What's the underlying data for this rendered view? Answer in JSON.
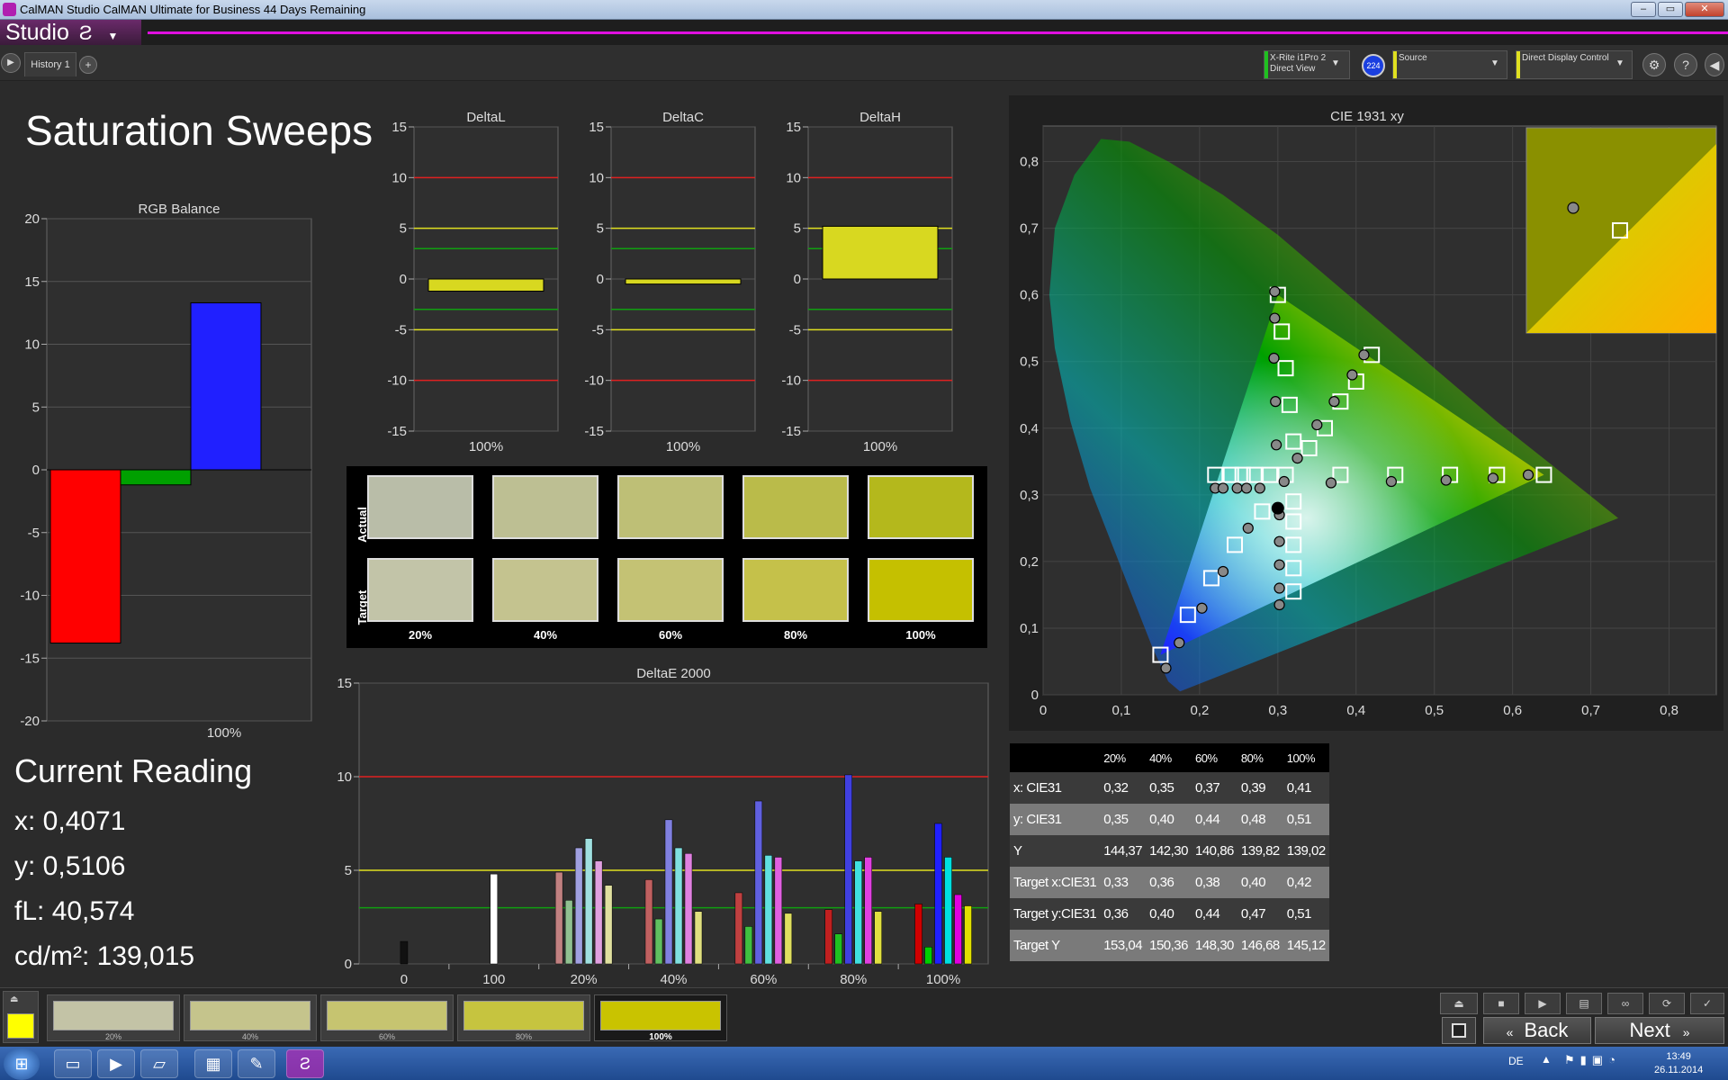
{
  "window": {
    "title": "CalMAN Studio CalMAN Ultimate for Business 44 Days Remaining",
    "minimize": "–",
    "maximize": "▭",
    "close": "✕"
  },
  "app": {
    "brand": "Studio",
    "brand_icon": "Ƨ",
    "tab": "History 1",
    "tab_add": "+"
  },
  "devices": {
    "meter": [
      "X-Rite i1Pro 2",
      "Direct View"
    ],
    "meter_badge": "224",
    "source": "Source",
    "display": "Direct Display Control"
  },
  "page_title": "Saturation Sweeps",
  "current_reading": {
    "title": "Current Reading",
    "x": "x: 0,4071",
    "y": "y: 0,5106",
    "fl": "fL: 40,574",
    "cdm": "cd/m²: 139,015"
  },
  "swatch_rows": {
    "actual": "Actual",
    "target": "Target"
  },
  "swatch_labels": [
    "20%",
    "40%",
    "60%",
    "80%",
    "100%"
  ],
  "swatch_colors": {
    "actual": [
      "#b9bda8",
      "#bdbf93",
      "#bebf76",
      "#babb4a",
      "#b4b81c"
    ],
    "target": [
      "#c2c4a8",
      "#c4c38f",
      "#c4c274",
      "#c5c14a",
      "#c5c000"
    ]
  },
  "table": {
    "header": [
      "",
      "20%",
      "40%",
      "60%",
      "80%",
      "100%"
    ],
    "rows": [
      [
        "x: CIE31",
        "0,32",
        "0,35",
        "0,37",
        "0,39",
        "0,41"
      ],
      [
        "y: CIE31",
        "0,35",
        "0,40",
        "0,44",
        "0,48",
        "0,51"
      ],
      [
        "Y",
        "144,37",
        "142,30",
        "140,86",
        "139,82",
        "139,02"
      ],
      [
        "Target x:CIE31",
        "0,33",
        "0,36",
        "0,38",
        "0,40",
        "0,42"
      ],
      [
        "Target y:CIE31",
        "0,36",
        "0,40",
        "0,44",
        "0,47",
        "0,51"
      ],
      [
        "Target Y",
        "153,04",
        "150,36",
        "148,30",
        "146,68",
        "145,12"
      ]
    ]
  },
  "bottom_swatches": [
    {
      "label": "20%",
      "color": "#c3c3a6"
    },
    {
      "label": "40%",
      "color": "#c5c48c"
    },
    {
      "label": "60%",
      "color": "#c6c470"
    },
    {
      "label": "80%",
      "color": "#c6c43f"
    },
    {
      "label": "100%",
      "color": "#c9c300"
    }
  ],
  "nav": {
    "back": "Back",
    "next": "Next"
  },
  "taskbar": {
    "lang": "DE",
    "time": "13:49",
    "date": "26.11.2014"
  },
  "chart_data": [
    {
      "type": "bar",
      "title": "RGB Balance",
      "categories": [
        "100%"
      ],
      "series": [
        {
          "color": "#ff0000",
          "value": -13.8
        },
        {
          "color": "#00a000",
          "value": -1.2
        },
        {
          "color": "#2020ff",
          "value": 13.3
        }
      ],
      "ylim": [
        -20,
        20
      ],
      "yticks": [
        -20,
        -15,
        -10,
        -5,
        0,
        5,
        10,
        15,
        20
      ]
    },
    {
      "type": "bar",
      "title": "DeltaL",
      "categories": [
        "100%"
      ],
      "values": [
        -1.2
      ],
      "ylim": [
        -15,
        15
      ],
      "yticks": [
        -15,
        -10,
        -5,
        0,
        5,
        10,
        15
      ]
    },
    {
      "type": "bar",
      "title": "DeltaC",
      "categories": [
        "100%"
      ],
      "values": [
        -0.5
      ],
      "ylim": [
        -15,
        15
      ],
      "yticks": [
        -15,
        -10,
        -5,
        0,
        5,
        10,
        15
      ]
    },
    {
      "type": "bar",
      "title": "DeltaH",
      "categories": [
        "100%"
      ],
      "values": [
        5.2
      ],
      "ylim": [
        -15,
        15
      ],
      "yticks": [
        -15,
        -10,
        -5,
        0,
        5,
        10,
        15
      ]
    },
    {
      "type": "bar",
      "title": "DeltaE 2000",
      "categories": [
        "0",
        "100",
        "20%",
        "40%",
        "60%",
        "80%",
        "100%"
      ],
      "ylim": [
        0,
        15
      ],
      "yticks": [
        0,
        5,
        10,
        15
      ],
      "groups": [
        {
          "cat": "0",
          "bars": [
            {
              "v": 1.2,
              "c": "#111"
            }
          ]
        },
        {
          "cat": "100",
          "bars": [
            {
              "v": 4.8,
              "c": "#ffffff"
            }
          ]
        },
        {
          "cat": "20%",
          "bars": [
            {
              "v": 4.9,
              "c": "#c08080"
            },
            {
              "v": 3.4,
              "c": "#90c090"
            },
            {
              "v": 6.2,
              "c": "#a0a0e0"
            },
            {
              "v": 6.7,
              "c": "#a0e0e0"
            },
            {
              "v": 5.5,
              "c": "#e0a0e0"
            },
            {
              "v": 4.2,
              "c": "#e0e0a0"
            }
          ]
        },
        {
          "cat": "40%",
          "bars": [
            {
              "v": 4.5,
              "c": "#c06060"
            },
            {
              "v": 2.4,
              "c": "#60c060"
            },
            {
              "v": 7.7,
              "c": "#8080e0"
            },
            {
              "v": 6.2,
              "c": "#80e0e0"
            },
            {
              "v": 5.9,
              "c": "#e080e0"
            },
            {
              "v": 2.8,
              "c": "#e0e080"
            }
          ]
        },
        {
          "cat": "60%",
          "bars": [
            {
              "v": 3.8,
              "c": "#c04040"
            },
            {
              "v": 2.0,
              "c": "#40c040"
            },
            {
              "v": 8.7,
              "c": "#6060e0"
            },
            {
              "v": 5.8,
              "c": "#60e0e0"
            },
            {
              "v": 5.7,
              "c": "#e060e0"
            },
            {
              "v": 2.7,
              "c": "#e0e060"
            }
          ]
        },
        {
          "cat": "80%",
          "bars": [
            {
              "v": 2.9,
              "c": "#c02020"
            },
            {
              "v": 1.6,
              "c": "#20c020"
            },
            {
              "v": 10.1,
              "c": "#4040e0"
            },
            {
              "v": 5.5,
              "c": "#40e0e0"
            },
            {
              "v": 5.7,
              "c": "#e040e0"
            },
            {
              "v": 2.8,
              "c": "#e0e040"
            }
          ]
        },
        {
          "cat": "100%",
          "bars": [
            {
              "v": 3.2,
              "c": "#d00000"
            },
            {
              "v": 0.9,
              "c": "#00d000"
            },
            {
              "v": 7.5,
              "c": "#2020ff"
            },
            {
              "v": 5.7,
              "c": "#00e0e0"
            },
            {
              "v": 3.7,
              "c": "#e000e0"
            },
            {
              "v": 3.1,
              "c": "#e0e000"
            }
          ]
        }
      ]
    },
    {
      "type": "scatter",
      "title": "CIE 1931 xy",
      "xlim": [
        0,
        0.85
      ],
      "ylim": [
        0,
        0.85
      ],
      "xticks": [
        "0",
        "0,1",
        "0,2",
        "0,3",
        "0,4",
        "0,5",
        "0,6",
        "0,7",
        "0,8"
      ],
      "yticks": [
        "0",
        "0,1",
        "0,2",
        "0,3",
        "0,4",
        "0,5",
        "0,6",
        "0,7",
        "0,8"
      ],
      "gamut": [
        [
          0.64,
          0.33
        ],
        [
          0.3,
          0.6
        ],
        [
          0.15,
          0.06
        ]
      ],
      "targets": [
        [
          0.3,
          0.6
        ],
        [
          0.305,
          0.545
        ],
        [
          0.31,
          0.49
        ],
        [
          0.315,
          0.435
        ],
        [
          0.32,
          0.38
        ],
        [
          0.42,
          0.51
        ],
        [
          0.4,
          0.47
        ],
        [
          0.38,
          0.44
        ],
        [
          0.36,
          0.4
        ],
        [
          0.34,
          0.37
        ],
        [
          0.64,
          0.33
        ],
        [
          0.58,
          0.33
        ],
        [
          0.52,
          0.33
        ],
        [
          0.45,
          0.33
        ],
        [
          0.38,
          0.33
        ],
        [
          0.15,
          0.06
        ],
        [
          0.185,
          0.12
        ],
        [
          0.215,
          0.175
        ],
        [
          0.245,
          0.225
        ],
        [
          0.28,
          0.275
        ],
        [
          0.32,
          0.155
        ],
        [
          0.32,
          0.19
        ],
        [
          0.32,
          0.225
        ],
        [
          0.32,
          0.26
        ],
        [
          0.32,
          0.29
        ],
        [
          0.22,
          0.33
        ],
        [
          0.24,
          0.33
        ],
        [
          0.255,
          0.33
        ],
        [
          0.27,
          0.33
        ],
        [
          0.29,
          0.33
        ],
        [
          0.31,
          0.33
        ]
      ],
      "actual": [
        [
          0.296,
          0.605
        ],
        [
          0.296,
          0.565
        ],
        [
          0.295,
          0.505
        ],
        [
          0.297,
          0.44
        ],
        [
          0.298,
          0.375
        ],
        [
          0.41,
          0.51
        ],
        [
          0.395,
          0.48
        ],
        [
          0.372,
          0.44
        ],
        [
          0.35,
          0.405
        ],
        [
          0.325,
          0.355
        ],
        [
          0.62,
          0.33
        ],
        [
          0.575,
          0.325
        ],
        [
          0.515,
          0.322
        ],
        [
          0.445,
          0.32
        ],
        [
          0.368,
          0.318
        ],
        [
          0.157,
          0.04
        ],
        [
          0.174,
          0.078
        ],
        [
          0.203,
          0.13
        ],
        [
          0.23,
          0.185
        ],
        [
          0.262,
          0.25
        ],
        [
          0.302,
          0.135
        ],
        [
          0.302,
          0.16
        ],
        [
          0.302,
          0.195
        ],
        [
          0.302,
          0.23
        ],
        [
          0.302,
          0.27
        ],
        [
          0.22,
          0.31
        ],
        [
          0.23,
          0.31
        ],
        [
          0.248,
          0.31
        ],
        [
          0.26,
          0.31
        ],
        [
          0.277,
          0.31
        ],
        [
          0.308,
          0.32
        ],
        [
          0.3,
          0.28
        ]
      ]
    }
  ]
}
